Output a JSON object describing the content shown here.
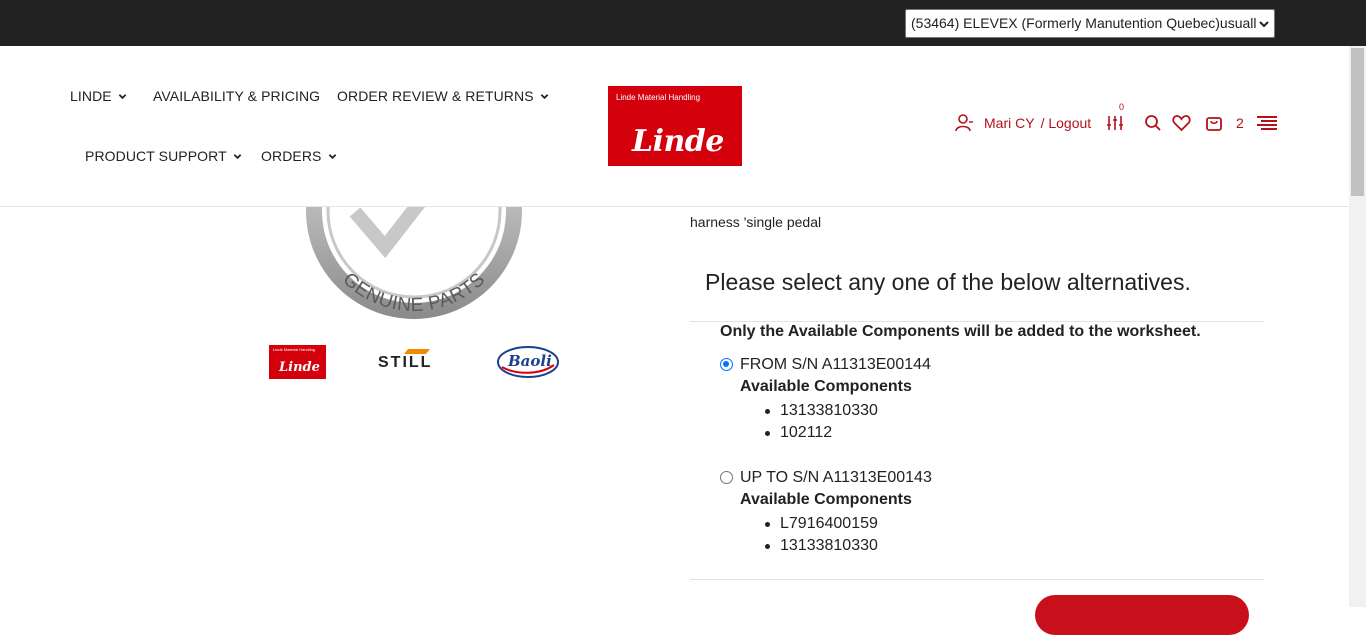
{
  "topbar": {
    "account_selected": "(53464) ELEVEX (Formerly Manutention Quebec)usuall"
  },
  "nav": {
    "linde": "LINDE",
    "availability": "AVAILABILITY & PRICING",
    "order_review": "ORDER REVIEW & RETURNS",
    "product_support": "PRODUCT SUPPORT",
    "orders": "ORDERS"
  },
  "logo": {
    "subtitle": "Linde Material Handling",
    "brand": "Linde"
  },
  "user": {
    "name": "Mari CY",
    "logout": "/ Logout",
    "compare_count": "0",
    "cart_count": "2"
  },
  "brands": {
    "genuine": "GENUINE PARTS",
    "linde": "Linde",
    "still": "STILL",
    "baoli": "Baoli"
  },
  "product": {
    "description": "harness 'single pedal",
    "prompt": "Please select any one of the below alternatives.",
    "note": "Only the Available Components will be added to the worksheet.",
    "options": [
      {
        "label": "FROM S/N A11313E00144",
        "heading": "Available Components",
        "selected": true,
        "components": [
          "13133810330",
          "102112"
        ]
      },
      {
        "label": "UP TO S/N A11313E00143",
        "heading": "Available Components",
        "selected": false,
        "components": [
          "L7916400159",
          "13133810330"
        ]
      }
    ]
  },
  "colors": {
    "brand_red": "#d4000c",
    "accent_red": "#b3121b",
    "topbar": "#222222",
    "radio_blue": "#0075ff"
  }
}
